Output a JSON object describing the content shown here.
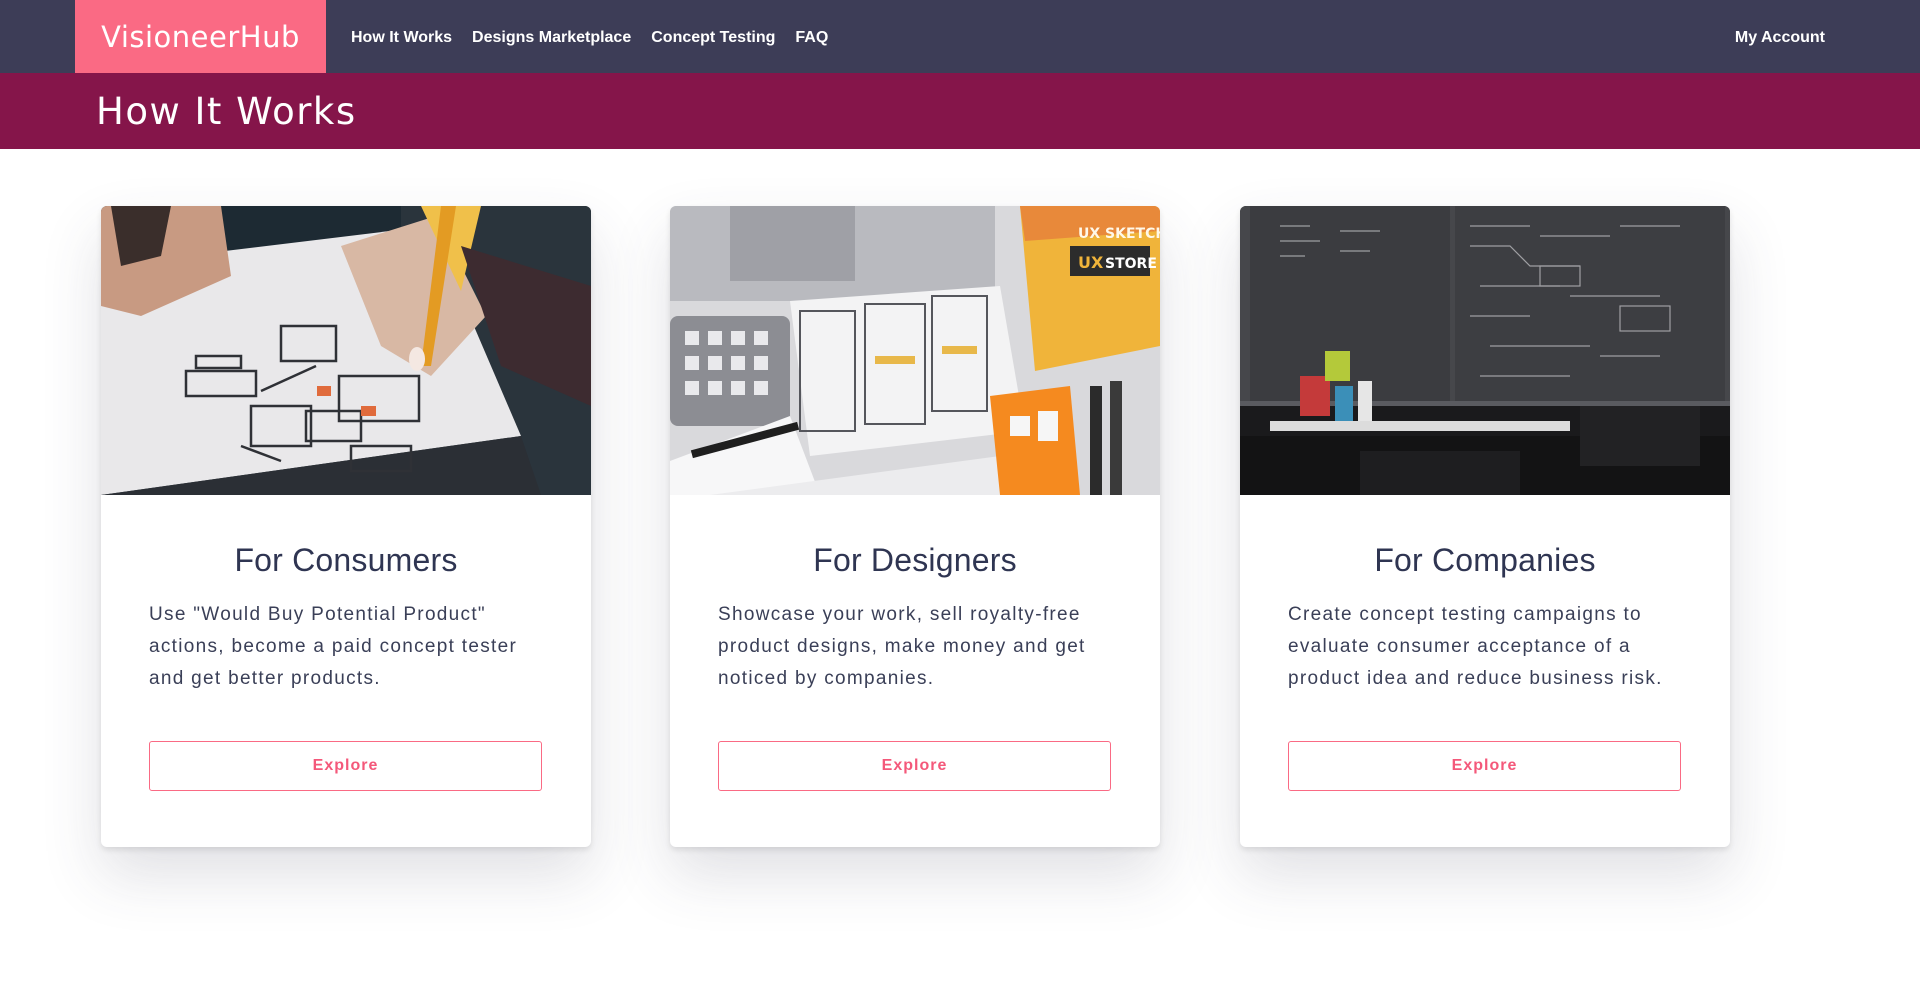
{
  "app": {
    "brand": "VisioneerHub"
  },
  "nav": {
    "links": [
      "How It Works",
      "Designs Marketplace",
      "Concept Testing",
      "FAQ"
    ],
    "account": "My Account"
  },
  "colors": {
    "navbar": "#3d3d57",
    "brand_accent": "#fa6a84",
    "page_header": "#85154a"
  },
  "header": {
    "title": "How It Works"
  },
  "cards": [
    {
      "title": "For Consumers",
      "text": "Use \"Would Buy Potential Product\" actions, become a paid concept tester and get better products.",
      "button": "Explore",
      "image": "hand-sketching-wireframes-photo"
    },
    {
      "title": "For Designers",
      "text": "Showcase your work, sell royalty-free product designs, make money and get noticed by companies.",
      "button": "Explore",
      "image": "ux-sketch-kit-flatlay-photo"
    },
    {
      "title": "For Companies",
      "text": "Create concept testing campaigns to evaluate consumer acceptance of a product idea and reduce business risk.",
      "button": "Explore",
      "image": "classroom-blackboard-photo"
    }
  ],
  "image_text": {
    "ux_sketch": "UX SKETCH",
    "ux": "UX",
    "store": "STORE"
  }
}
